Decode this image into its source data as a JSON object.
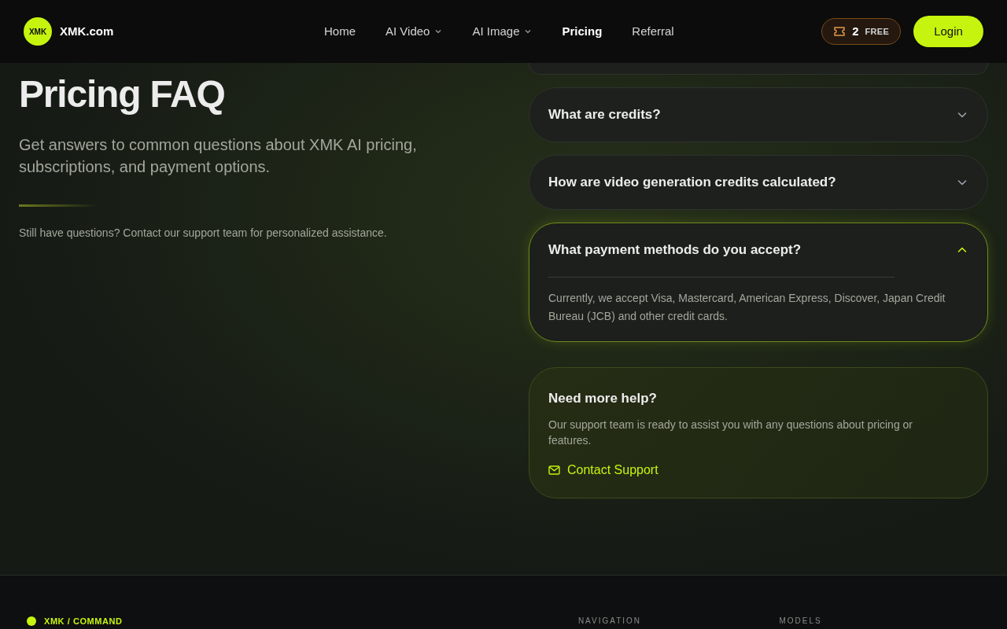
{
  "header": {
    "brand": "XMK.com",
    "logo_text": "XMK",
    "nav": [
      {
        "label": "Home",
        "dropdown": false,
        "selected": false
      },
      {
        "label": "AI Video",
        "dropdown": true,
        "selected": false
      },
      {
        "label": "AI Image",
        "dropdown": true,
        "selected": false
      },
      {
        "label": "Pricing",
        "dropdown": false,
        "selected": true
      },
      {
        "label": "Referral",
        "dropdown": false,
        "selected": false
      }
    ],
    "credits": {
      "count": "2",
      "label": "FREE"
    },
    "login": "Login"
  },
  "intro": {
    "title": "Pricing FAQ",
    "subtitle": "Get answers to common questions about XMK AI pricing, subscriptions, and payment options.",
    "note": "Still have questions? Contact our support team for personalized assistance."
  },
  "faq": [
    {
      "question": "What are credits?",
      "expanded": false
    },
    {
      "question": "How are video generation credits calculated?",
      "expanded": false
    },
    {
      "question": "What payment methods do you accept?",
      "expanded": true,
      "answer": "Currently, we accept Visa, Mastercard, American Express, Discover, Japan Credit Bureau (JCB) and other credit cards."
    }
  ],
  "help": {
    "title": "Need more help?",
    "text": "Our support team is ready to assist you with any questions about pricing or features.",
    "link": "Contact Support"
  },
  "footer": {
    "brand": "XMK / COMMAND",
    "columns": [
      "NAVIGATION",
      "MODELS"
    ]
  }
}
